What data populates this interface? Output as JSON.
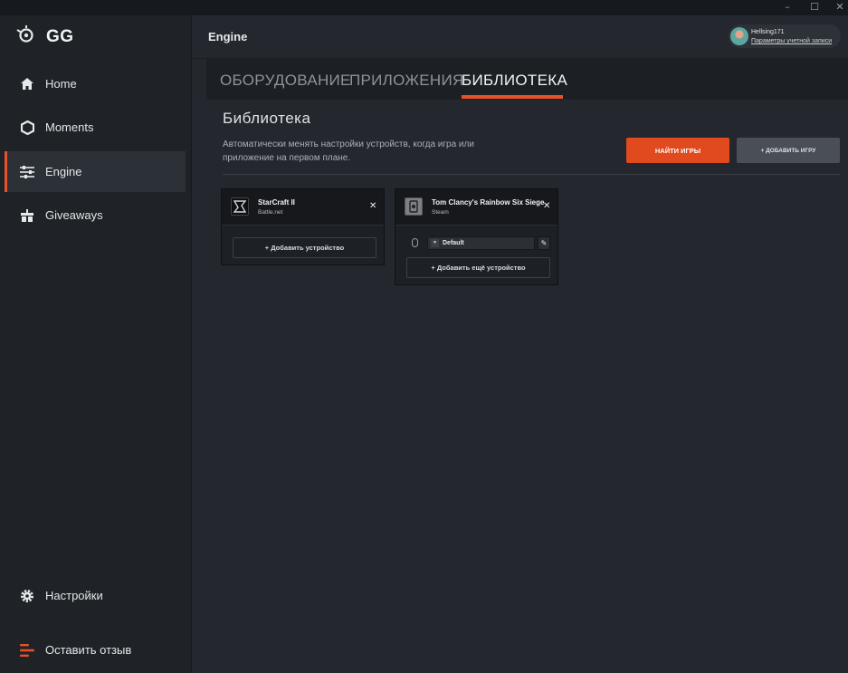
{
  "window": {
    "controls": [
      "–",
      "☐",
      "✕"
    ]
  },
  "sidebar": {
    "logo_text": "GG",
    "items": [
      {
        "label": "Home",
        "icon": "home-icon"
      },
      {
        "label": "Moments",
        "icon": "hexagon-icon"
      },
      {
        "label": "Engine",
        "icon": "sliders-icon",
        "active": true
      },
      {
        "label": "Giveaways",
        "icon": "gift-icon"
      }
    ],
    "bottom_items": [
      {
        "label": "Настройки",
        "icon": "gear-icon"
      },
      {
        "label": "Оставить отзыв",
        "icon": "feedback-icon"
      }
    ]
  },
  "header": {
    "title": "Engine",
    "account": {
      "username": "Hellsing171",
      "settings_link": "Параметры учетной записи"
    }
  },
  "tabs": [
    {
      "label": "ОБОРУДОВАНИЕ"
    },
    {
      "label": "ПРИЛОЖЕНИЯ"
    },
    {
      "label": "БИБЛИОТЕКА",
      "active": true
    }
  ],
  "library": {
    "title": "Библиотека",
    "description": "Автоматически менять настройки устройств, когда игра или приложение на первом плане.",
    "find_games_button": "НАЙТИ ИГРЫ",
    "add_game_button": "+ ДОБАВИТЬ ИГРУ",
    "games": [
      {
        "name": "StarCraft II",
        "platform": "Battle.net",
        "add_device_label": "+ Добавить устройство"
      },
      {
        "name": "Tom Clancy's Rainbow Six Siege",
        "platform": "Steam",
        "profile": "Default",
        "add_device_label": "+ Добавить ещё устройство"
      }
    ]
  },
  "colors": {
    "accent": "#e8512a",
    "background": "#24282e",
    "sidebar": "#1f2327"
  }
}
